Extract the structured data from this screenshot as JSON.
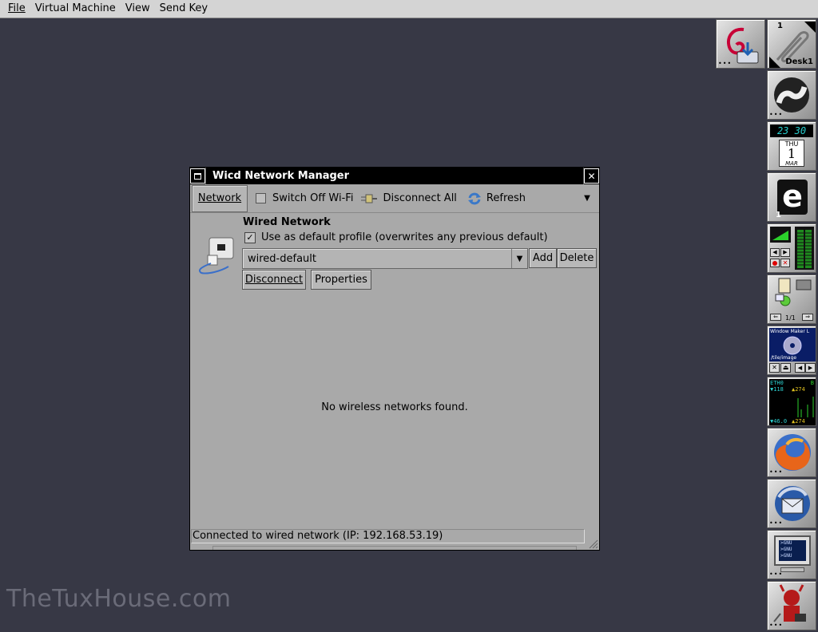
{
  "menubar": {
    "items": [
      {
        "label": "File"
      },
      {
        "label": "Virtual Machine"
      },
      {
        "label": "View"
      },
      {
        "label": "Send Key"
      }
    ]
  },
  "window": {
    "title": "Wicd Network Manager",
    "close_glyph": "✕",
    "toolbar": {
      "network_label": "Network",
      "switch_wifi_label": "Switch Off Wi-Fi",
      "disconnect_all_label": "Disconnect All",
      "refresh_label": "Refresh",
      "more_glyph": "▼"
    },
    "wired": {
      "heading": "Wired Network",
      "default_profile_label": "Use as default profile (overwrites any previous default)",
      "default_profile_checked": true,
      "profile_value": "wired-default",
      "add_label": "Add",
      "delete_label": "Delete",
      "disconnect_label": "Disconnect",
      "properties_label": "Properties"
    },
    "empty_message": "No wireless networks found.",
    "status": "Connected to wired network (IP: 192.168.53.19)"
  },
  "dock": {
    "desk_number": "1",
    "desk_label": "Desk1",
    "clock_time": "23 30",
    "calendar_day": "THU",
    "calendar_date": "1",
    "calendar_month": "MAR",
    "e_badge": "1",
    "pager": "1/1",
    "wmaker_text": "Window Maker L",
    "wmaker_path": "/tile/image",
    "net_iface": "ETH0",
    "net_letter": "B",
    "net_rx": "118",
    "net_tx": "274",
    "net_rx2": "46.0",
    "net_tx2": "274",
    "term_lines": [
      ">GNU",
      ">GNU",
      ">GNU"
    ]
  },
  "watermark": "TheTuxHouse.com",
  "colors": {
    "desktop": "#373845",
    "window_bg": "#a9a9a9",
    "titlebar": "#000000"
  }
}
